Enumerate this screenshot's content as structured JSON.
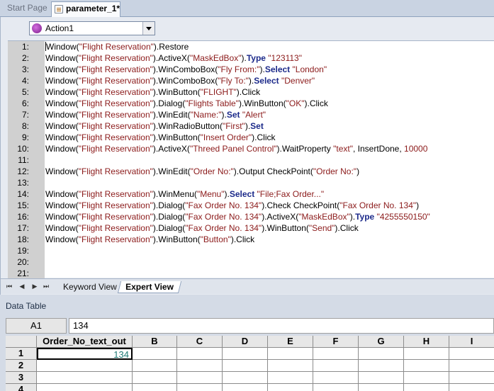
{
  "tabs": {
    "start": "Start Page",
    "active": "parameter_1*"
  },
  "action_select": {
    "value": "Action1"
  },
  "code_lines": [
    {
      "n": "1:",
      "parts": [
        [
          "obj",
          "Window("
        ],
        [
          "str",
          "\"Flight Reservation\""
        ],
        [
          "obj",
          ").Restore"
        ]
      ]
    },
    {
      "n": "2:",
      "parts": [
        [
          "obj",
          "Window("
        ],
        [
          "str",
          "\"Flight Reservation\""
        ],
        [
          "obj",
          ").ActiveX("
        ],
        [
          "str",
          "\"MaskEdBox\""
        ],
        [
          "obj",
          ")."
        ],
        [
          "kw",
          "Type"
        ],
        [
          "obj",
          " "
        ],
        [
          "str",
          "\"123113\""
        ]
      ]
    },
    {
      "n": "3:",
      "parts": [
        [
          "obj",
          "Window("
        ],
        [
          "str",
          "\"Flight Reservation\""
        ],
        [
          "obj",
          ").WinComboBox("
        ],
        [
          "str",
          "\"Fly From:\""
        ],
        [
          "obj",
          ")."
        ],
        [
          "kw",
          "Select"
        ],
        [
          "obj",
          " "
        ],
        [
          "str",
          "\"London\""
        ]
      ]
    },
    {
      "n": "4:",
      "parts": [
        [
          "obj",
          "Window("
        ],
        [
          "str",
          "\"Flight Reservation\""
        ],
        [
          "obj",
          ").WinComboBox("
        ],
        [
          "str",
          "\"Fly To:\""
        ],
        [
          "obj",
          ")."
        ],
        [
          "kw",
          "Select"
        ],
        [
          "obj",
          " "
        ],
        [
          "str",
          "\"Denver\""
        ]
      ]
    },
    {
      "n": "5:",
      "parts": [
        [
          "obj",
          "Window("
        ],
        [
          "str",
          "\"Flight Reservation\""
        ],
        [
          "obj",
          ").WinButton("
        ],
        [
          "str",
          "\"FLIGHT\""
        ],
        [
          "obj",
          ").Click"
        ]
      ]
    },
    {
      "n": "6:",
      "parts": [
        [
          "obj",
          "Window("
        ],
        [
          "str",
          "\"Flight Reservation\""
        ],
        [
          "obj",
          ").Dialog("
        ],
        [
          "str",
          "\"Flights Table\""
        ],
        [
          "obj",
          ").WinButton("
        ],
        [
          "str",
          "\"OK\""
        ],
        [
          "obj",
          ").Click"
        ]
      ]
    },
    {
      "n": "7:",
      "parts": [
        [
          "obj",
          "Window("
        ],
        [
          "str",
          "\"Flight Reservation\""
        ],
        [
          "obj",
          ").WinEdit("
        ],
        [
          "str",
          "\"Name:\""
        ],
        [
          "obj",
          ")."
        ],
        [
          "kw",
          "Set"
        ],
        [
          "obj",
          " "
        ],
        [
          "str",
          "\"Alert\""
        ]
      ]
    },
    {
      "n": "8:",
      "parts": [
        [
          "obj",
          "Window("
        ],
        [
          "str",
          "\"Flight Reservation\""
        ],
        [
          "obj",
          ").WinRadioButton("
        ],
        [
          "str",
          "\"First\""
        ],
        [
          "obj",
          ")."
        ],
        [
          "kw",
          "Set"
        ]
      ]
    },
    {
      "n": "9:",
      "parts": [
        [
          "obj",
          "Window("
        ],
        [
          "str",
          "\"Flight Reservation\""
        ],
        [
          "obj",
          ").WinButton("
        ],
        [
          "str",
          "\"Insert Order\""
        ],
        [
          "obj",
          ").Click"
        ]
      ]
    },
    {
      "n": "10:",
      "parts": [
        [
          "obj",
          "Window("
        ],
        [
          "str",
          "\"Flight Reservation\""
        ],
        [
          "obj",
          ").ActiveX("
        ],
        [
          "str",
          "\"Threed Panel Control\""
        ],
        [
          "obj",
          ").WaitProperty "
        ],
        [
          "str",
          "\"text\""
        ],
        [
          "obj",
          ", InsertDone, "
        ],
        [
          "str",
          "10000"
        ]
      ]
    },
    {
      "n": "11:",
      "parts": []
    },
    {
      "n": "12:",
      "parts": [
        [
          "obj",
          "Window("
        ],
        [
          "str",
          "\"Flight Reservation\""
        ],
        [
          "obj",
          ").WinEdit("
        ],
        [
          "str",
          "\"Order No:\""
        ],
        [
          "obj",
          ").Output CheckPoint("
        ],
        [
          "str",
          "\"Order No:\""
        ],
        [
          "obj",
          ")"
        ]
      ]
    },
    {
      "n": "13:",
      "parts": []
    },
    {
      "n": "14:",
      "parts": [
        [
          "obj",
          "Window("
        ],
        [
          "str",
          "\"Flight Reservation\""
        ],
        [
          "obj",
          ").WinMenu("
        ],
        [
          "str",
          "\"Menu\""
        ],
        [
          "obj",
          ")."
        ],
        [
          "kw",
          "Select"
        ],
        [
          "obj",
          " "
        ],
        [
          "str",
          "\"File;Fax Order...\""
        ]
      ]
    },
    {
      "n": "15:",
      "parts": [
        [
          "obj",
          "Window("
        ],
        [
          "str",
          "\"Flight Reservation\""
        ],
        [
          "obj",
          ").Dialog("
        ],
        [
          "str",
          "\"Fax Order No. 134\""
        ],
        [
          "obj",
          ").Check CheckPoint("
        ],
        [
          "str",
          "\"Fax Order No. 134\""
        ],
        [
          "obj",
          ")"
        ]
      ]
    },
    {
      "n": "16:",
      "parts": [
        [
          "obj",
          "Window("
        ],
        [
          "str",
          "\"Flight Reservation\""
        ],
        [
          "obj",
          ").Dialog("
        ],
        [
          "str",
          "\"Fax Order No. 134\""
        ],
        [
          "obj",
          ").ActiveX("
        ],
        [
          "str",
          "\"MaskEdBox\""
        ],
        [
          "obj",
          ")."
        ],
        [
          "kw",
          "Type"
        ],
        [
          "obj",
          " "
        ],
        [
          "str",
          "\"4255550150\""
        ]
      ]
    },
    {
      "n": "17:",
      "parts": [
        [
          "obj",
          "Window("
        ],
        [
          "str",
          "\"Flight Reservation\""
        ],
        [
          "obj",
          ").Dialog("
        ],
        [
          "str",
          "\"Fax Order No. 134\""
        ],
        [
          "obj",
          ").WinButton("
        ],
        [
          "str",
          "\"Send\""
        ],
        [
          "obj",
          ").Click"
        ]
      ]
    },
    {
      "n": "18:",
      "parts": [
        [
          "obj",
          "Window("
        ],
        [
          "str",
          "\"Flight Reservation\""
        ],
        [
          "obj",
          ").WinButton("
        ],
        [
          "str",
          "\"Button\""
        ],
        [
          "obj",
          ").Click"
        ]
      ]
    },
    {
      "n": "19:",
      "parts": []
    },
    {
      "n": "20:",
      "parts": []
    },
    {
      "n": "21:",
      "parts": []
    }
  ],
  "view_tabs": {
    "keyword": "Keyword View",
    "expert": "Expert View"
  },
  "nav_glyphs": [
    "⏮",
    "◀",
    "▶",
    "⏭"
  ],
  "data_table": {
    "title": "Data Table",
    "cell_ref": "A1",
    "formula_value": "134",
    "columns": [
      "Order_No_text_out",
      "B",
      "C",
      "D",
      "E",
      "F",
      "G",
      "H",
      "I"
    ],
    "rows": [
      "1",
      "2",
      "3",
      "4"
    ],
    "cells": [
      [
        "134"
      ],
      [
        ""
      ],
      [
        ""
      ],
      [
        ""
      ]
    ]
  }
}
